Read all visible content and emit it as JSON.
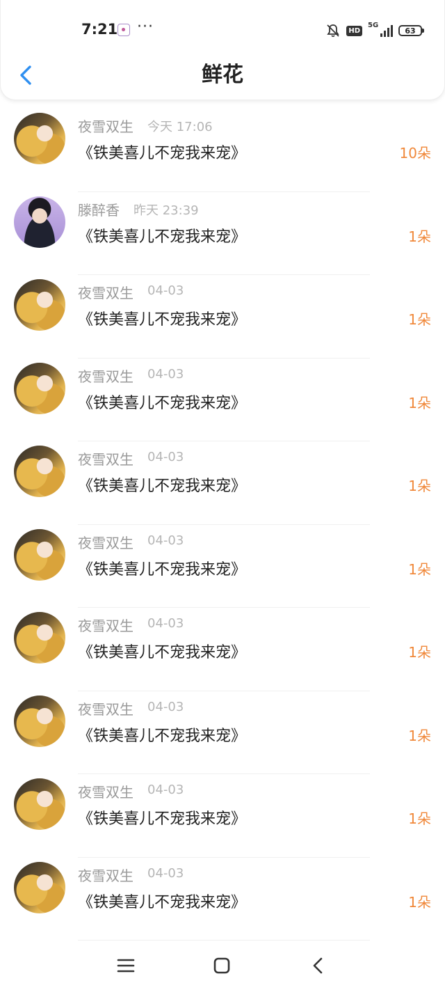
{
  "status_bar": {
    "time": "7:21",
    "dots": "···",
    "hd": "HD",
    "network": "5G",
    "battery": "63"
  },
  "header": {
    "title": "鲜花"
  },
  "rows": [
    {
      "name": "夜雪双生",
      "time": "今天 17:06",
      "title": "《铁美喜儿不宠我来宠》",
      "count": "10朵",
      "avatar": "girl"
    },
    {
      "name": "滕醉香",
      "time": "昨天 23:39",
      "title": "《铁美喜儿不宠我来宠》",
      "count": "1朵",
      "avatar": "boy"
    },
    {
      "name": "夜雪双生",
      "time": "04-03",
      "title": "《铁美喜儿不宠我来宠》",
      "count": "1朵",
      "avatar": "girl"
    },
    {
      "name": "夜雪双生",
      "time": "04-03",
      "title": "《铁美喜儿不宠我来宠》",
      "count": "1朵",
      "avatar": "girl"
    },
    {
      "name": "夜雪双生",
      "time": "04-03",
      "title": "《铁美喜儿不宠我来宠》",
      "count": "1朵",
      "avatar": "girl"
    },
    {
      "name": "夜雪双生",
      "time": "04-03",
      "title": "《铁美喜儿不宠我来宠》",
      "count": "1朵",
      "avatar": "girl"
    },
    {
      "name": "夜雪双生",
      "time": "04-03",
      "title": "《铁美喜儿不宠我来宠》",
      "count": "1朵",
      "avatar": "girl"
    },
    {
      "name": "夜雪双生",
      "time": "04-03",
      "title": "《铁美喜儿不宠我来宠》",
      "count": "1朵",
      "avatar": "girl"
    },
    {
      "name": "夜雪双生",
      "time": "04-03",
      "title": "《铁美喜儿不宠我来宠》",
      "count": "1朵",
      "avatar": "girl"
    },
    {
      "name": "夜雪双生",
      "time": "04-03",
      "title": "《铁美喜儿不宠我来宠》",
      "count": "1朵",
      "avatar": "girl"
    }
  ],
  "colors": {
    "accent_blue": "#2f8ff0",
    "count_orange": "#f0883a"
  }
}
